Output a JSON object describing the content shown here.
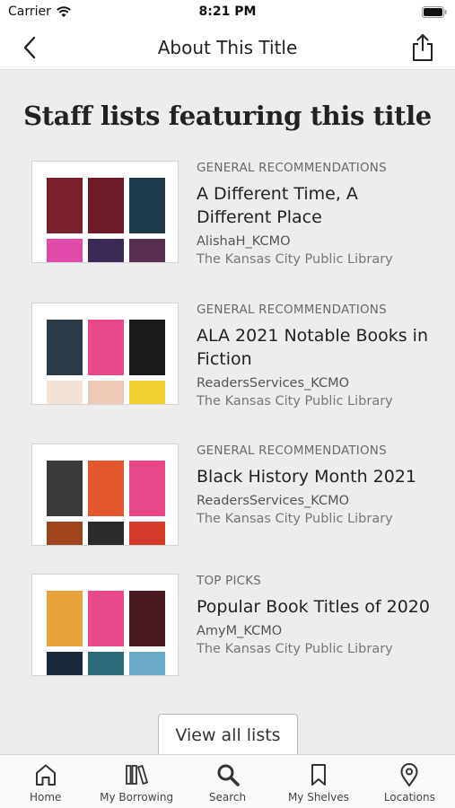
{
  "status": {
    "carrier": "Carrier",
    "time": "8:21 PM"
  },
  "nav": {
    "title": "About This Title",
    "back_icon": "chevron-left-icon",
    "share_icon": "share-icon"
  },
  "section_title": "Staff lists featuring this title",
  "lists": [
    {
      "category": "GENERAL RECOMMENDATIONS",
      "title": "A Different Time, A Different Place",
      "owner": "AlishaH_KCMO",
      "library": "The Kansas City Public Library",
      "covers": [
        "#7a1f2e",
        "#6e1a28",
        "#1f3a4a",
        "#e04aa8",
        "#3a2a55",
        "#5a3050"
      ]
    },
    {
      "category": "GENERAL RECOMMENDATIONS",
      "title": "ALA 2021 Notable Books in Fiction",
      "owner": "ReadersServices_KCMO",
      "library": "The Kansas City Public Library",
      "covers": [
        "#2b3a44",
        "#e8488a",
        "#1a1a1a",
        "#f2e4d6",
        "#f0c8b8",
        "#f2d230"
      ]
    },
    {
      "category": "GENERAL RECOMMENDATIONS",
      "title": "Black History Month 2021",
      "owner": "ReadersServices_KCMO",
      "library": "The Kansas City Public Library",
      "covers": [
        "#3a3a3a",
        "#e2572d",
        "#e8488a",
        "#a0441e",
        "#2a2a2a",
        "#d43a2a"
      ]
    },
    {
      "category": "TOP PICKS",
      "title": "Popular Book Titles of 2020",
      "owner": "AmyM_KCMO",
      "library": "The Kansas City Public Library",
      "covers": [
        "#e8a23a",
        "#e8488a",
        "#4a1a22",
        "#1a2a3a",
        "#2a6a7a",
        "#6aa8c8"
      ]
    }
  ],
  "view_all_label": "View all lists",
  "tabs": [
    {
      "label": "Home",
      "icon": "home-icon"
    },
    {
      "label": "My Borrowing",
      "icon": "books-icon"
    },
    {
      "label": "Search",
      "icon": "search-icon"
    },
    {
      "label": "My Shelves",
      "icon": "bookmark-icon"
    },
    {
      "label": "Locations",
      "icon": "location-pin-icon"
    }
  ]
}
